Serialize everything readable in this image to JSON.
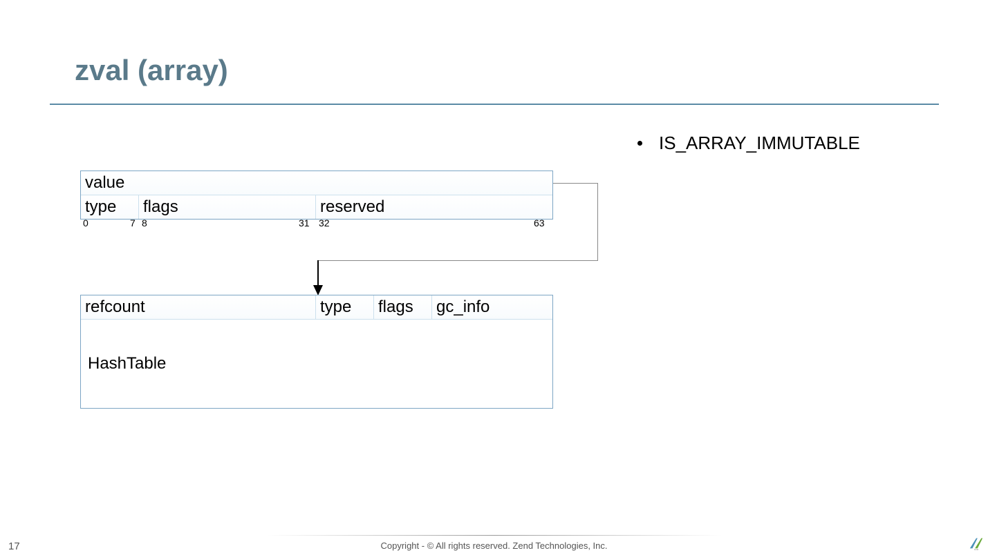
{
  "title": "zval (array)",
  "block1": {
    "value": "value",
    "type": "type",
    "flags": "flags",
    "reserved": "reserved"
  },
  "bits": {
    "b0": "0",
    "b7": "7",
    "b8": "8",
    "b31": "31",
    "b32": "32",
    "b63": "63"
  },
  "block2": {
    "refcount": "refcount",
    "type": "type",
    "flags": "flags",
    "gc_info": "gc_info",
    "hashtable": "HashTable"
  },
  "bullet": "IS_ARRAY_IMMUTABLE",
  "footer": "Copyright - © All rights reserved. Zend Technologies, Inc.",
  "page": "17"
}
